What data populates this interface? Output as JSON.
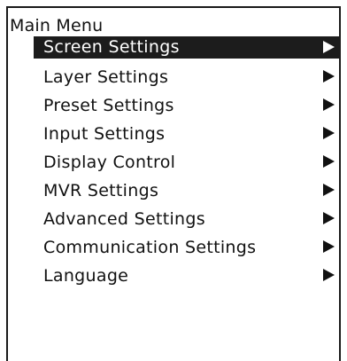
{
  "menu": {
    "title": "Main Menu",
    "selected_index": 0,
    "items": [
      {
        "label": "Screen Settings",
        "icon": "triangle-right-icon"
      },
      {
        "label": "Layer Settings",
        "icon": "triangle-right-icon"
      },
      {
        "label": "Preset Settings",
        "icon": "triangle-right-icon"
      },
      {
        "label": "Input Settings",
        "icon": "triangle-right-icon"
      },
      {
        "label": "Display Control",
        "icon": "triangle-right-icon"
      },
      {
        "label": "MVR Settings",
        "icon": "triangle-right-icon"
      },
      {
        "label": "Advanced Settings",
        "icon": "triangle-right-icon"
      },
      {
        "label": "Communication Settings",
        "icon": "triangle-right-icon"
      },
      {
        "label": "Language",
        "icon": "triangle-right-icon"
      }
    ]
  },
  "colors": {
    "highlight_background": "#1c1c1c",
    "highlight_text": "#ffffff",
    "text": "#111111",
    "background": "#ffffff"
  }
}
